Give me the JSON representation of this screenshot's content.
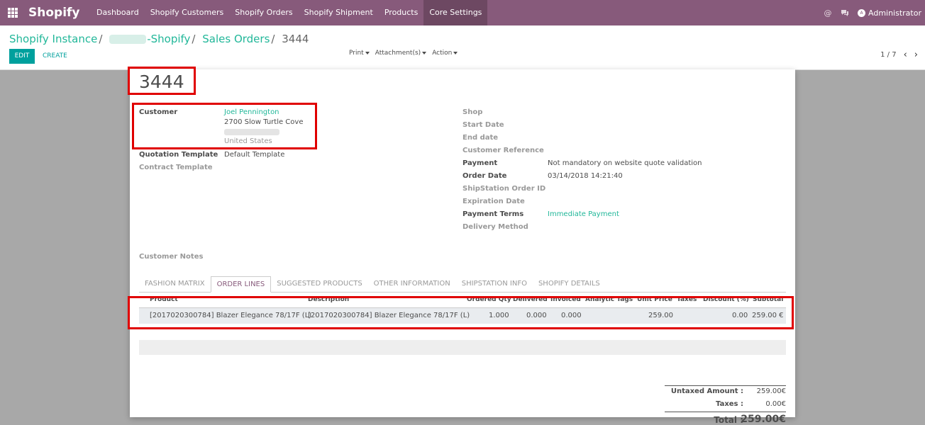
{
  "navbar": {
    "brand": "Shopify",
    "menu": [
      "Dashboard",
      "Shopify Customers",
      "Shopify Orders",
      "Shopify Shipment",
      "Products",
      "Core Settings"
    ],
    "active_menu": "Core Settings",
    "user": "Administrator",
    "user_initial": "A",
    "accent_color": "#875a7b"
  },
  "breadcrumb": {
    "instance": "Shopify Instance",
    "shop_suffix": "-Shopify",
    "sales_orders": "Sales Orders",
    "current": "3444"
  },
  "buttons": {
    "edit": "EDIT",
    "create": "CREATE"
  },
  "sidebar": {
    "print": "Print",
    "attachments": "Attachment(s)",
    "action": "Action"
  },
  "pager": {
    "value": "1 / 7"
  },
  "record": {
    "name": "3444",
    "left_fields": {
      "customer_label": "Customer",
      "customer_name": "Joel Pennington",
      "customer_address": "2700 Slow Turtle Cove",
      "customer_country": "United States",
      "quotation_template_label": "Quotation Template",
      "quotation_template_value": "Default Template",
      "contract_template_label": "Contract Template"
    },
    "right_fields": {
      "shop": "Shop",
      "start_date": "Start Date",
      "end_date": "End date",
      "customer_reference": "Customer Reference",
      "payment_label": "Payment",
      "payment_value": "Not mandatory on website quote validation",
      "order_date_label": "Order Date",
      "order_date_value": "03/14/2018 14:21:40",
      "shipstation_order_id": "ShipStation Order ID",
      "expiration_date": "Expiration Date",
      "payment_terms_label": "Payment Terms",
      "payment_terms_value": "Immediate Payment",
      "delivery_method": "Delivery Method"
    },
    "customer_notes": "Customer Notes"
  },
  "tabs": [
    "FASHION MATRIX",
    "ORDER LINES",
    "SUGGESTED PRODUCTS",
    "OTHER INFORMATION",
    "SHIPSTATION INFO",
    "SHOPIFY DETAILS"
  ],
  "active_tab": "ORDER LINES",
  "order_lines": {
    "headers": {
      "product": "Product",
      "description": "Description",
      "ordered_qty": "Ordered Qty",
      "delivered": "Delivered",
      "invoiced": "Invoiced",
      "analytic_tags": "Analytic Tags",
      "unit_price": "Unit Price",
      "taxes": "Taxes",
      "discount": "Discount (%)",
      "subtotal": "Subtotal"
    },
    "rows": [
      {
        "product": "[2017020300784] Blazer Elegance 78/17F (L)",
        "description": "[2017020300784] Blazer Elegance 78/17F (L)",
        "ordered_qty": "1.000",
        "delivered": "0.000",
        "invoiced": "0.000",
        "unit_price": "259.00",
        "discount": "0.00",
        "subtotal": "259.00 €"
      }
    ]
  },
  "totals": {
    "untaxed_label": "Untaxed Amount :",
    "untaxed_value": "259.00€",
    "taxes_label": "Taxes :",
    "taxes_value": "0.00€",
    "total_label": "Total :",
    "total_value": "259.00€"
  }
}
